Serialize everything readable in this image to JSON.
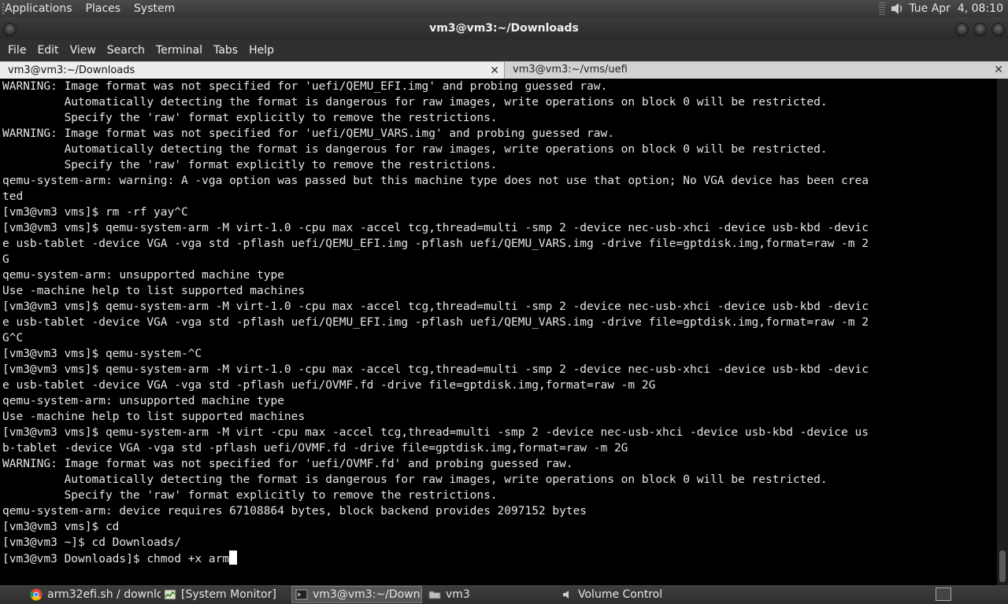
{
  "top_panel": {
    "menus": [
      "Applications",
      "Places",
      "System"
    ],
    "clock": "Tue Apr  4, 08:10"
  },
  "window": {
    "title": "vm3@vm3:~/Downloads"
  },
  "menubar": [
    "File",
    "Edit",
    "View",
    "Search",
    "Terminal",
    "Tabs",
    "Help"
  ],
  "tabs": [
    {
      "label": "vm3@vm3:~/Downloads",
      "close": "✕"
    },
    {
      "label": "vm3@vm3:~/vms/uefi",
      "close": "✕"
    }
  ],
  "terminal": {
    "lines": [
      "WARNING: Image format was not specified for 'uefi/QEMU_EFI.img' and probing guessed raw.",
      "         Automatically detecting the format is dangerous for raw images, write operations on block 0 will be restricted.",
      "         Specify the 'raw' format explicitly to remove the restrictions.",
      "WARNING: Image format was not specified for 'uefi/QEMU_VARS.img' and probing guessed raw.",
      "         Automatically detecting the format is dangerous for raw images, write operations on block 0 will be restricted.",
      "         Specify the 'raw' format explicitly to remove the restrictions.",
      "qemu-system-arm: warning: A -vga option was passed but this machine type does not use that option; No VGA device has been crea",
      "ted",
      "[vm3@vm3 vms]$ rm -rf yay^C",
      "[vm3@vm3 vms]$ qemu-system-arm -M virt-1.0 -cpu max -accel tcg,thread=multi -smp 2 -device nec-usb-xhci -device usb-kbd -devic",
      "e usb-tablet -device VGA -vga std -pflash uefi/QEMU_EFI.img -pflash uefi/QEMU_VARS.img -drive file=gptdisk.img,format=raw -m 2",
      "G",
      "qemu-system-arm: unsupported machine type",
      "Use -machine help to list supported machines",
      "[vm3@vm3 vms]$ qemu-system-arm -M virt-1.0 -cpu max -accel tcg,thread=multi -smp 2 -device nec-usb-xhci -device usb-kbd -devic",
      "e usb-tablet -device VGA -vga std -pflash uefi/QEMU_EFI.img -pflash uefi/QEMU_VARS.img -drive file=gptdisk.img,format=raw -m 2",
      "G^C",
      "[vm3@vm3 vms]$ qemu-system-^C",
      "[vm3@vm3 vms]$ qemu-system-arm -M virt-1.0 -cpu max -accel tcg,thread=multi -smp 2 -device nec-usb-xhci -device usb-kbd -devic",
      "e usb-tablet -device VGA -vga std -pflash uefi/OVMF.fd -drive file=gptdisk.img,format=raw -m 2G",
      "qemu-system-arm: unsupported machine type",
      "Use -machine help to list supported machines",
      "[vm3@vm3 vms]$ qemu-system-arm -M virt -cpu max -accel tcg,thread=multi -smp 2 -device nec-usb-xhci -device usb-kbd -device us",
      "b-tablet -device VGA -vga std -pflash uefi/OVMF.fd -drive file=gptdisk.img,format=raw -m 2G",
      "WARNING: Image format was not specified for 'uefi/OVMF.fd' and probing guessed raw.",
      "         Automatically detecting the format is dangerous for raw images, write operations on block 0 will be restricted.",
      "         Specify the 'raw' format explicitly to remove the restrictions.",
      "qemu-system-arm: device requires 67108864 bytes, block backend provides 2097152 bytes",
      "[vm3@vm3 vms]$ cd",
      "[vm3@vm3 ~]$ cd Downloads/"
    ],
    "current_line": "[vm3@vm3 Downloads]$ chmod +x arm"
  },
  "taskbar": [
    {
      "label": "arm32efi.sh / downlo...",
      "icon": "chrome-icon"
    },
    {
      "label": "[System Monitor]",
      "icon": "system-monitor-icon"
    },
    {
      "label": "vm3@vm3:~/Downl...",
      "icon": "terminal-icon"
    },
    {
      "label": "vm3",
      "icon": "folder-icon"
    },
    {
      "label": "Volume Control",
      "icon": "volume-icon"
    }
  ]
}
